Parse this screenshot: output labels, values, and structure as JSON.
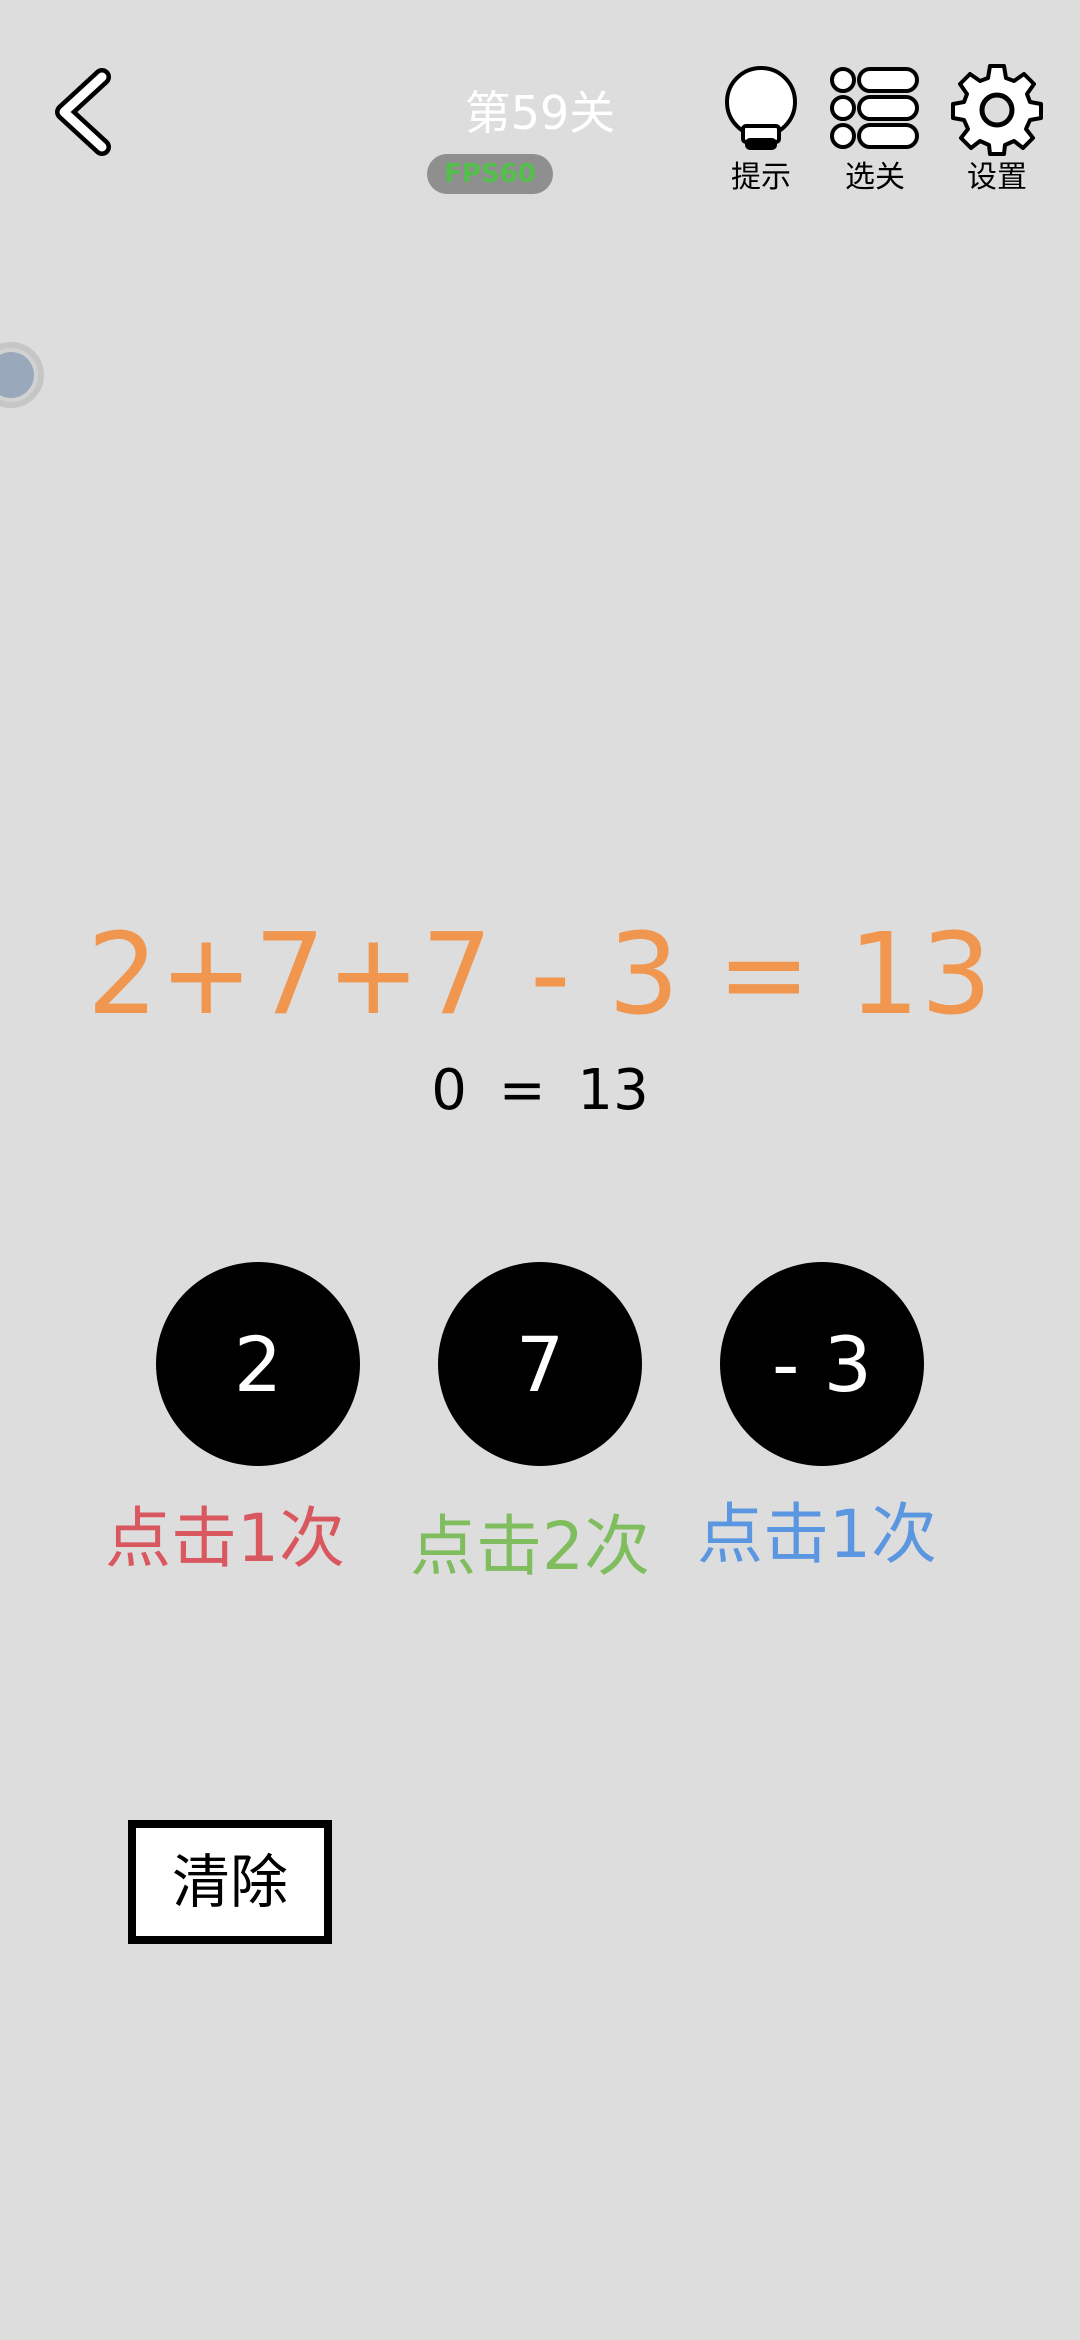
{
  "header": {
    "level_title": "第59关",
    "fps_badge": "FPS60",
    "tools": {
      "hint_label": "提示",
      "levels_label": "选关",
      "settings_label": "设置"
    },
    "icons": {
      "back": "chevron-left-icon",
      "hint": "lightbulb-icon",
      "levels": "list-icon",
      "settings": "gear-icon"
    }
  },
  "puzzle": {
    "equation": "2+7+7 - 3 = 13",
    "current_result": "0 = 13"
  },
  "number_buttons": [
    {
      "value": "2",
      "tap_label": "点击1次",
      "label_color": "#d9585f"
    },
    {
      "value": "7",
      "tap_label": "点击2次",
      "label_color": "#7fbd5e"
    },
    {
      "value": "- 3",
      "tap_label": "点击1次",
      "label_color": "#5b96e0"
    }
  ],
  "clear_button": {
    "label": "清除"
  },
  "colors": {
    "background": "#dddddd",
    "equation": "#f0964e",
    "circle": "#000000"
  }
}
